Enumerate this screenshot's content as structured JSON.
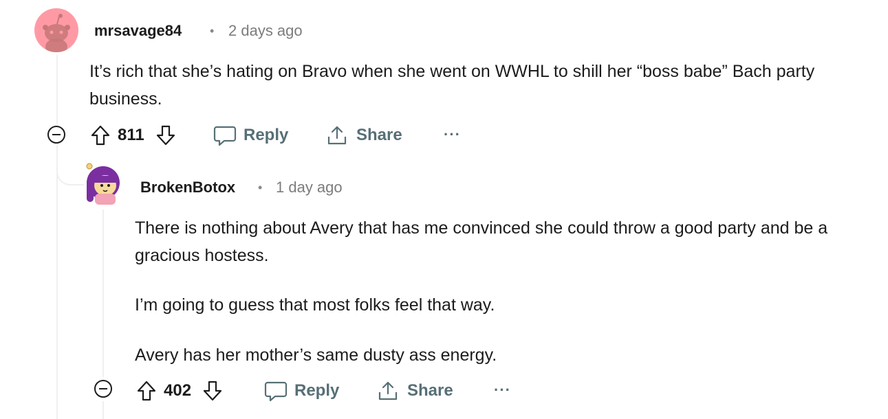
{
  "comment1": {
    "username": "mrsavage84",
    "separator": "•",
    "time": "2 days ago",
    "body": "It’s rich that she’s hating on Bravo when she went on WWHL to shill her “boss babe” Bach party business.",
    "score": "811",
    "reply_label": "Reply",
    "share_label": "Share",
    "more_label": "···",
    "avatar_bg": "#ff9aa5"
  },
  "comment2": {
    "username": "BrokenBotox",
    "separator": "•",
    "time": "1 day ago",
    "paragraphs": [
      "There is nothing about Avery that has me convinced she could throw a good party and be a gracious hostess.",
      "I’m going to guess that most folks feel that way.",
      "Avery has her mother’s same dusty ass energy."
    ],
    "score": "402",
    "reply_label": "Reply",
    "share_label": "Share",
    "more_label": "···"
  }
}
